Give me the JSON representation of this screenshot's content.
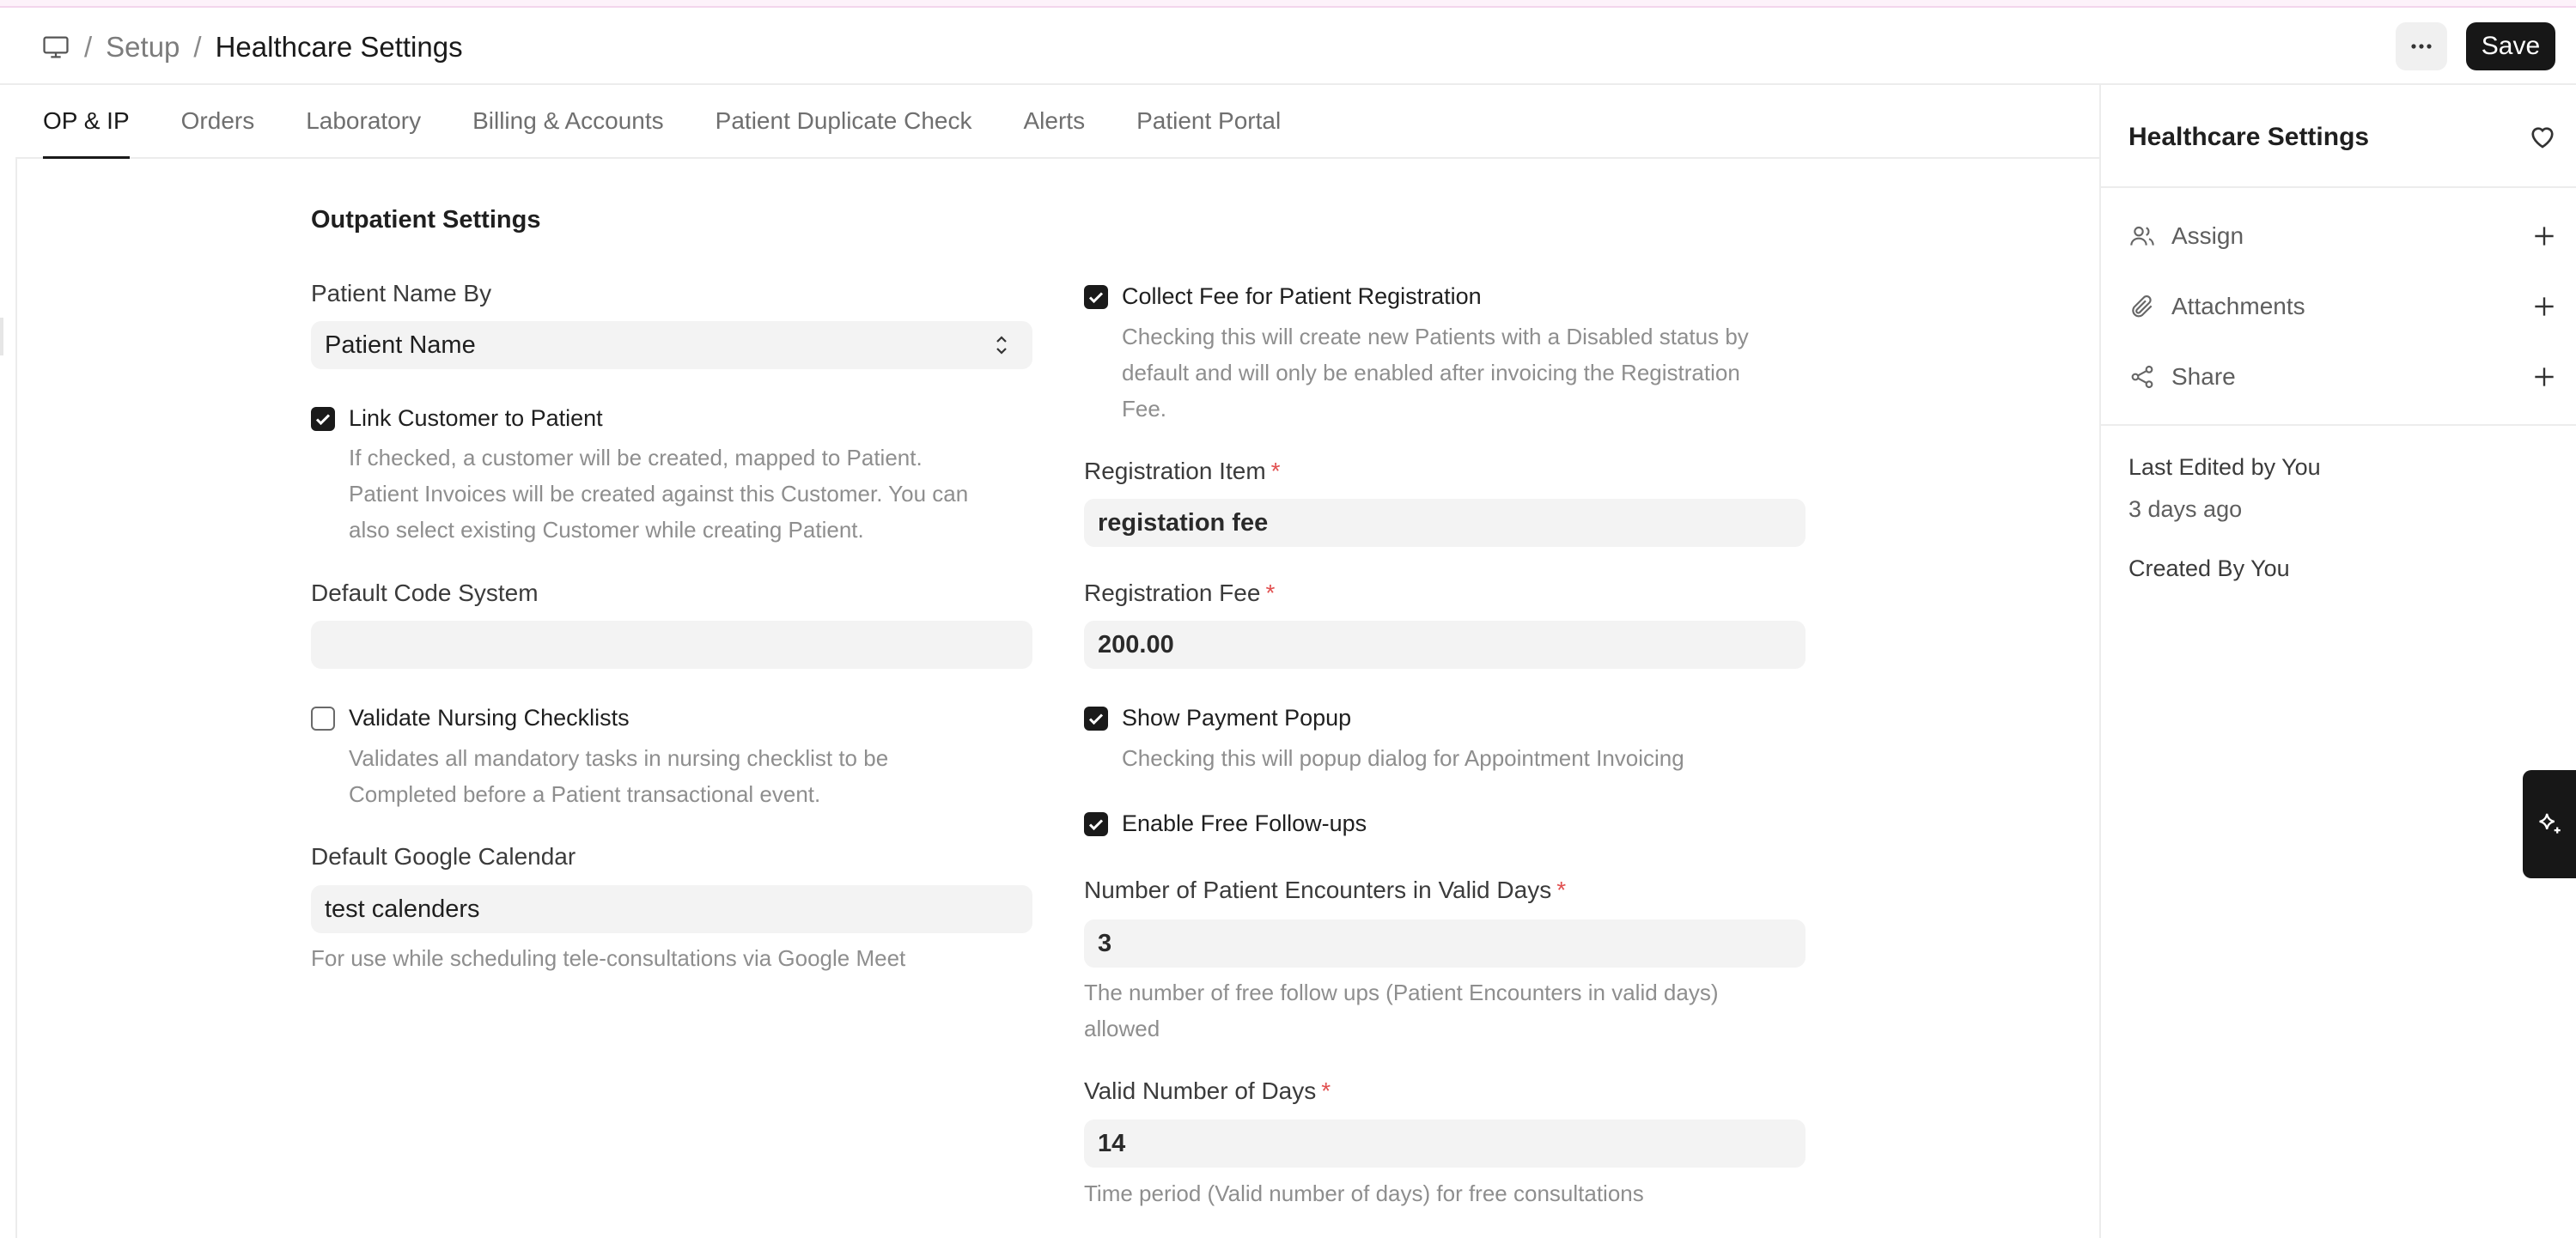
{
  "header": {
    "breadcrumb": {
      "section": "Setup",
      "current": "Healthcare Settings",
      "separator": "/"
    },
    "save_label": "Save",
    "more_label": "···"
  },
  "tabs": [
    {
      "label": "OP & IP",
      "active": true
    },
    {
      "label": "Orders"
    },
    {
      "label": "Laboratory"
    },
    {
      "label": "Billing & Accounts"
    },
    {
      "label": "Patient Duplicate Check"
    },
    {
      "label": "Alerts"
    },
    {
      "label": "Patient Portal"
    }
  ],
  "form": {
    "section_title": "Outpatient Settings",
    "patient_name_by": {
      "label": "Patient Name By",
      "value": "Patient Name"
    },
    "link_customer": {
      "label": "Link Customer to Patient",
      "checked": true,
      "desc1": "If checked, a customer will be created, mapped to Patient.",
      "desc2": "Patient Invoices will be created against this Customer. You can",
      "desc3": "also select existing Customer while creating Patient."
    },
    "default_code_system": {
      "label": "Default Code System",
      "value": ""
    },
    "validate_nursing": {
      "label": "Validate Nursing Checklists",
      "checked": false,
      "desc1": "Validates all mandatory tasks in nursing checklist to be",
      "desc2": "Completed before a Patient transactional event."
    },
    "google_calendar": {
      "label": "Default Google Calendar",
      "value": "test calenders",
      "desc": "For use while scheduling tele-consultations via Google Meet"
    },
    "collect_fee": {
      "label": "Collect Fee for Patient Registration",
      "checked": true,
      "desc1": "Checking this will create new Patients with a Disabled status by",
      "desc2": "default and will only be enabled after invoicing the Registration",
      "desc3": "Fee."
    },
    "registration_item": {
      "label": "Registration Item",
      "required": "*",
      "value": "registation fee"
    },
    "registration_fee": {
      "label": "Registration Fee",
      "required": "*",
      "value": "200.00"
    },
    "show_payment_popup": {
      "label": "Show Payment Popup",
      "checked": true,
      "desc": "Checking this will popup dialog for Appointment Invoicing"
    },
    "free_followups": {
      "label": "Enable Free Follow-ups",
      "checked": true
    },
    "encounters_valid_days": {
      "label": "Number of Patient Encounters in Valid Days",
      "required": "*",
      "value": "3",
      "desc1": "The number of free follow ups (Patient Encounters in valid days)",
      "desc2": "allowed"
    },
    "valid_days": {
      "label": "Valid Number of Days",
      "required": "*",
      "value": "14",
      "desc": "Time period (Valid number of days) for free consultations"
    }
  },
  "sidebar": {
    "title": "Healthcare Settings",
    "actions": [
      {
        "label": "Assign",
        "icon": "users-icon"
      },
      {
        "label": "Attachments",
        "icon": "paperclip-icon"
      },
      {
        "label": "Share",
        "icon": "share-icon"
      }
    ],
    "last_edited": "Last Edited by You",
    "last_edited_time": "3 days ago",
    "created_by": "Created By You"
  },
  "colors": {
    "primary": "#171717",
    "required": "#e15050",
    "input_bg": "#f3f3f3",
    "muted_text": "#8e8e8e"
  },
  "icons": [
    "monitor-icon",
    "more-icon",
    "heart-icon",
    "plus-icon",
    "sparkle-icon",
    "select-arrows-icon",
    "check-icon"
  ]
}
